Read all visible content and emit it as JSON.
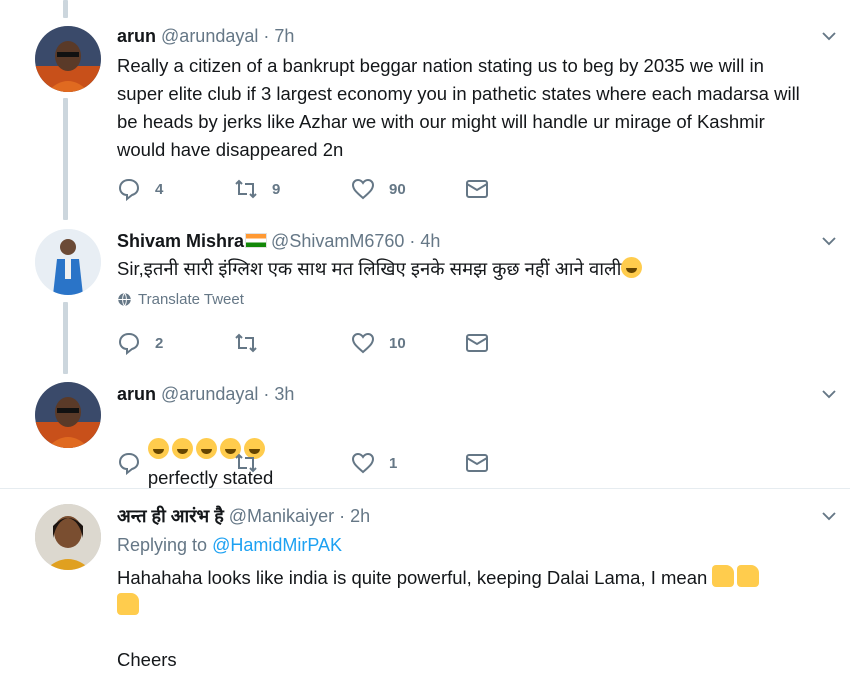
{
  "colors": {
    "accent": "#1da1f2",
    "muted": "#657786",
    "text": "#14171a",
    "thread_line": "#ccd6dd"
  },
  "tweets": [
    {
      "fullname": "arun",
      "handle": "@arundayal",
      "sep": "·",
      "time": "7h",
      "text": "Really a citizen of a bankrupt beggar nation stating us to beg by 2035 we will in super elite club if 3 largest economy you in pathetic states where each madarsa will be heads by jerks like Azhar we with our might will handle ur mirage of Kashmir would have disappeared 2n",
      "replies": "4",
      "retweets": "9",
      "likes": "90"
    },
    {
      "fullname": "Shivam Mishra",
      "handle": "@ShivamM6760",
      "sep": "·",
      "time": "4h",
      "text": "Sir,इतनी सारी इंग्लिश एक साथ मत लिखिए इनके समझ कुछ नहीं आने वाली",
      "translate": "Translate Tweet",
      "replies": "2",
      "retweets": "",
      "likes": "10"
    },
    {
      "fullname": "arun",
      "handle": "@arundayal",
      "sep": "·",
      "time": "3h",
      "text": "perfectly stated",
      "replies": "",
      "retweets": "",
      "likes": "1"
    },
    {
      "fullname": "अन्त ही आरंभ है",
      "handle": "@Manikaiyer",
      "sep": "·",
      "time": "2h",
      "replying_prefix": "Replying to",
      "replying_to": "@HamidMirPAK",
      "text": "Hahahaha looks like india is quite powerful, keeping Dalai Lama, I mean",
      "text2": "Cheers"
    }
  ]
}
